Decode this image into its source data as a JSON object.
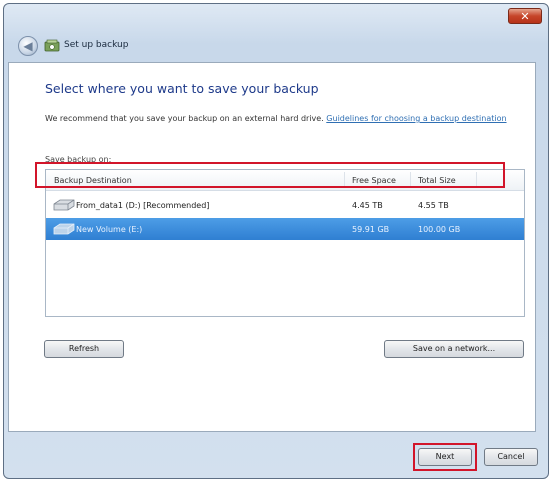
{
  "window": {
    "title": "Set up backup",
    "close_label": "✕"
  },
  "content": {
    "heading": "Select where you want to save your backup",
    "recommend_text": "We recommend that you save your backup on an external hard drive.",
    "guidelines_link": "Guidelines for choosing a backup destination",
    "save_label": "Save backup on:"
  },
  "table": {
    "columns": [
      "Backup Destination",
      "Free Space",
      "Total Size"
    ],
    "rows": [
      {
        "name": "From_data1 (D:) [Recommended]",
        "free": "4.45 TB",
        "total": "4.55 TB",
        "selected": false
      },
      {
        "name": "New Volume (E:)",
        "free": "59.91 GB",
        "total": "100.00 GB",
        "selected": true
      }
    ]
  },
  "buttons": {
    "refresh": "Refresh",
    "save_network": "Save on a network...",
    "next": "Next",
    "cancel": "Cancel"
  },
  "colors": {
    "heading": "#1e3a8a",
    "selection": "#2f7fd2",
    "highlight": "#d2152a"
  }
}
